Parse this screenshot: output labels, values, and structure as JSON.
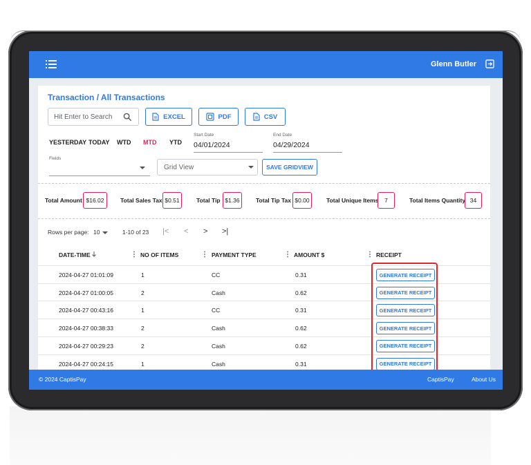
{
  "topbar": {
    "user_name": "Glenn Butler",
    "menu_icon": "hamburger-menu-icon",
    "logout_icon": "logout-icon"
  },
  "page": {
    "title": "Transaction / All Transactions"
  },
  "search": {
    "placeholder": "Hit Enter to Search"
  },
  "export_buttons": {
    "excel": "EXCEL",
    "pdf": "PDF",
    "csv": "CSV"
  },
  "periods": [
    "YESTERDAY",
    "TODAY",
    "WTD",
    "MTD",
    "YTD"
  ],
  "active_period": "MTD",
  "start_date": {
    "label": "Start Date",
    "value": "04/01/2024"
  },
  "end_date": {
    "label": "End Date",
    "value": "04/29/2024"
  },
  "fields": {
    "label": "Fields",
    "value": ""
  },
  "view_select": {
    "value": "Grid View"
  },
  "save_gridview": "SAVE GRIDVIEW",
  "totals": [
    {
      "label": "Total Amount",
      "value": "$16.02"
    },
    {
      "label": "Total Sales Tax",
      "value": "$0.51"
    },
    {
      "label": "Total Tip",
      "value": "$1.36"
    },
    {
      "label": "Total Tip Tax",
      "value": "$0.00"
    },
    {
      "label": "Total Unique Items",
      "value": "7"
    },
    {
      "label": "Total Items Quantity",
      "value": "34"
    }
  ],
  "pagination": {
    "rows_label": "Rows per page:",
    "rows_value": "10",
    "range": "1-10 of 23"
  },
  "table": {
    "headers": [
      "DATE-TIME",
      "NO OF ITEMS",
      "PAYMENT TYPE",
      "AMOUNT $",
      "RECEIPT"
    ],
    "rows": [
      {
        "datetime": "2024-04-27 01:01:09",
        "items": "1",
        "payment": "CC",
        "amount": "0.31",
        "receipt": "GENERATE RECEIPT"
      },
      {
        "datetime": "2024-04-27 01:00:05",
        "items": "2",
        "payment": "Cash",
        "amount": "0.62",
        "receipt": "GENERATE RECEIPT"
      },
      {
        "datetime": "2024-04-27 00:43:16",
        "items": "1",
        "payment": "CC",
        "amount": "0.31",
        "receipt": "GENERATE RECEIPT"
      },
      {
        "datetime": "2024-04-27 00:38:33",
        "items": "2",
        "payment": "Cash",
        "amount": "0.62",
        "receipt": "GENERATE RECEIPT"
      },
      {
        "datetime": "2024-04-27 00:29:23",
        "items": "2",
        "payment": "Cash",
        "amount": "0.62",
        "receipt": "GENERATE RECEIPT"
      },
      {
        "datetime": "2024-04-27 00:24:15",
        "items": "1",
        "payment": "Cash",
        "amount": "0.31",
        "receipt": "GENERATE RECEIPT"
      }
    ]
  },
  "footer": {
    "copyright": "© 2024 CaptisPay",
    "brand_link": "CaptisPay",
    "about_link": "About Us"
  },
  "colors": {
    "brand_blue": "#2f7ae5",
    "active_red": "#e01e5a",
    "highlight_red": "#e0262e"
  }
}
